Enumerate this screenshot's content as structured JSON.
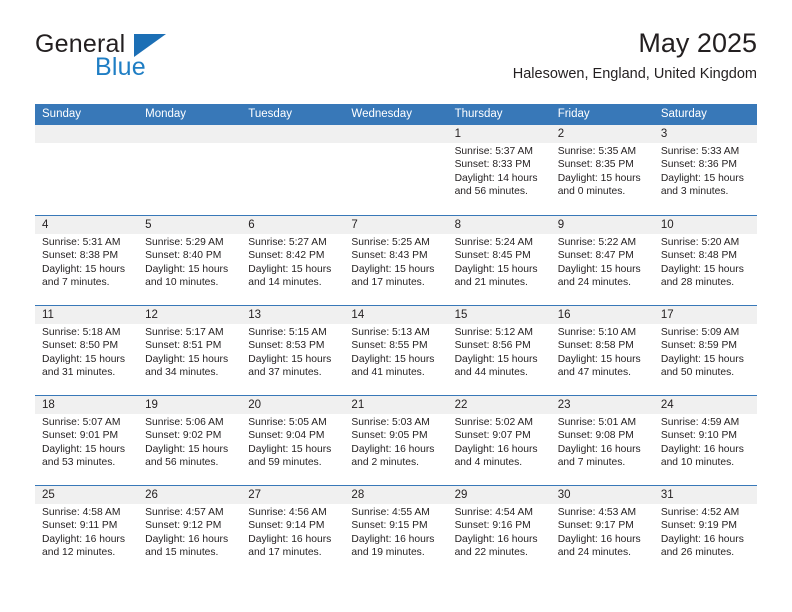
{
  "brand": {
    "name_top": "General",
    "name_bottom": "Blue",
    "triangle_color": "#1c6fb5",
    "blue_text_color": "#1f7ec4"
  },
  "header": {
    "title": "May 2025",
    "subtitle": "Halesowen, England, United Kingdom"
  },
  "theme": {
    "header_row_bg": "#3878b8",
    "header_row_text": "#ffffff",
    "daynum_band_bg": "#f0f0f0",
    "row_separator": "#3878b8",
    "body_text": "#231f20"
  },
  "weekdays": [
    "Sunday",
    "Monday",
    "Tuesday",
    "Wednesday",
    "Thursday",
    "Friday",
    "Saturday"
  ],
  "weeks": [
    [
      {
        "day": "",
        "lines": []
      },
      {
        "day": "",
        "lines": []
      },
      {
        "day": "",
        "lines": []
      },
      {
        "day": "",
        "lines": []
      },
      {
        "day": "1",
        "lines": [
          "Sunrise: 5:37 AM",
          "Sunset: 8:33 PM",
          "Daylight: 14 hours",
          "and 56 minutes."
        ]
      },
      {
        "day": "2",
        "lines": [
          "Sunrise: 5:35 AM",
          "Sunset: 8:35 PM",
          "Daylight: 15 hours",
          "and 0 minutes."
        ]
      },
      {
        "day": "3",
        "lines": [
          "Sunrise: 5:33 AM",
          "Sunset: 8:36 PM",
          "Daylight: 15 hours",
          "and 3 minutes."
        ]
      }
    ],
    [
      {
        "day": "4",
        "lines": [
          "Sunrise: 5:31 AM",
          "Sunset: 8:38 PM",
          "Daylight: 15 hours",
          "and 7 minutes."
        ]
      },
      {
        "day": "5",
        "lines": [
          "Sunrise: 5:29 AM",
          "Sunset: 8:40 PM",
          "Daylight: 15 hours",
          "and 10 minutes."
        ]
      },
      {
        "day": "6",
        "lines": [
          "Sunrise: 5:27 AM",
          "Sunset: 8:42 PM",
          "Daylight: 15 hours",
          "and 14 minutes."
        ]
      },
      {
        "day": "7",
        "lines": [
          "Sunrise: 5:25 AM",
          "Sunset: 8:43 PM",
          "Daylight: 15 hours",
          "and 17 minutes."
        ]
      },
      {
        "day": "8",
        "lines": [
          "Sunrise: 5:24 AM",
          "Sunset: 8:45 PM",
          "Daylight: 15 hours",
          "and 21 minutes."
        ]
      },
      {
        "day": "9",
        "lines": [
          "Sunrise: 5:22 AM",
          "Sunset: 8:47 PM",
          "Daylight: 15 hours",
          "and 24 minutes."
        ]
      },
      {
        "day": "10",
        "lines": [
          "Sunrise: 5:20 AM",
          "Sunset: 8:48 PM",
          "Daylight: 15 hours",
          "and 28 minutes."
        ]
      }
    ],
    [
      {
        "day": "11",
        "lines": [
          "Sunrise: 5:18 AM",
          "Sunset: 8:50 PM",
          "Daylight: 15 hours",
          "and 31 minutes."
        ]
      },
      {
        "day": "12",
        "lines": [
          "Sunrise: 5:17 AM",
          "Sunset: 8:51 PM",
          "Daylight: 15 hours",
          "and 34 minutes."
        ]
      },
      {
        "day": "13",
        "lines": [
          "Sunrise: 5:15 AM",
          "Sunset: 8:53 PM",
          "Daylight: 15 hours",
          "and 37 minutes."
        ]
      },
      {
        "day": "14",
        "lines": [
          "Sunrise: 5:13 AM",
          "Sunset: 8:55 PM",
          "Daylight: 15 hours",
          "and 41 minutes."
        ]
      },
      {
        "day": "15",
        "lines": [
          "Sunrise: 5:12 AM",
          "Sunset: 8:56 PM",
          "Daylight: 15 hours",
          "and 44 minutes."
        ]
      },
      {
        "day": "16",
        "lines": [
          "Sunrise: 5:10 AM",
          "Sunset: 8:58 PM",
          "Daylight: 15 hours",
          "and 47 minutes."
        ]
      },
      {
        "day": "17",
        "lines": [
          "Sunrise: 5:09 AM",
          "Sunset: 8:59 PM",
          "Daylight: 15 hours",
          "and 50 minutes."
        ]
      }
    ],
    [
      {
        "day": "18",
        "lines": [
          "Sunrise: 5:07 AM",
          "Sunset: 9:01 PM",
          "Daylight: 15 hours",
          "and 53 minutes."
        ]
      },
      {
        "day": "19",
        "lines": [
          "Sunrise: 5:06 AM",
          "Sunset: 9:02 PM",
          "Daylight: 15 hours",
          "and 56 minutes."
        ]
      },
      {
        "day": "20",
        "lines": [
          "Sunrise: 5:05 AM",
          "Sunset: 9:04 PM",
          "Daylight: 15 hours",
          "and 59 minutes."
        ]
      },
      {
        "day": "21",
        "lines": [
          "Sunrise: 5:03 AM",
          "Sunset: 9:05 PM",
          "Daylight: 16 hours",
          "and 2 minutes."
        ]
      },
      {
        "day": "22",
        "lines": [
          "Sunrise: 5:02 AM",
          "Sunset: 9:07 PM",
          "Daylight: 16 hours",
          "and 4 minutes."
        ]
      },
      {
        "day": "23",
        "lines": [
          "Sunrise: 5:01 AM",
          "Sunset: 9:08 PM",
          "Daylight: 16 hours",
          "and 7 minutes."
        ]
      },
      {
        "day": "24",
        "lines": [
          "Sunrise: 4:59 AM",
          "Sunset: 9:10 PM",
          "Daylight: 16 hours",
          "and 10 minutes."
        ]
      }
    ],
    [
      {
        "day": "25",
        "lines": [
          "Sunrise: 4:58 AM",
          "Sunset: 9:11 PM",
          "Daylight: 16 hours",
          "and 12 minutes."
        ]
      },
      {
        "day": "26",
        "lines": [
          "Sunrise: 4:57 AM",
          "Sunset: 9:12 PM",
          "Daylight: 16 hours",
          "and 15 minutes."
        ]
      },
      {
        "day": "27",
        "lines": [
          "Sunrise: 4:56 AM",
          "Sunset: 9:14 PM",
          "Daylight: 16 hours",
          "and 17 minutes."
        ]
      },
      {
        "day": "28",
        "lines": [
          "Sunrise: 4:55 AM",
          "Sunset: 9:15 PM",
          "Daylight: 16 hours",
          "and 19 minutes."
        ]
      },
      {
        "day": "29",
        "lines": [
          "Sunrise: 4:54 AM",
          "Sunset: 9:16 PM",
          "Daylight: 16 hours",
          "and 22 minutes."
        ]
      },
      {
        "day": "30",
        "lines": [
          "Sunrise: 4:53 AM",
          "Sunset: 9:17 PM",
          "Daylight: 16 hours",
          "and 24 minutes."
        ]
      },
      {
        "day": "31",
        "lines": [
          "Sunrise: 4:52 AM",
          "Sunset: 9:19 PM",
          "Daylight: 16 hours",
          "and 26 minutes."
        ]
      }
    ]
  ]
}
